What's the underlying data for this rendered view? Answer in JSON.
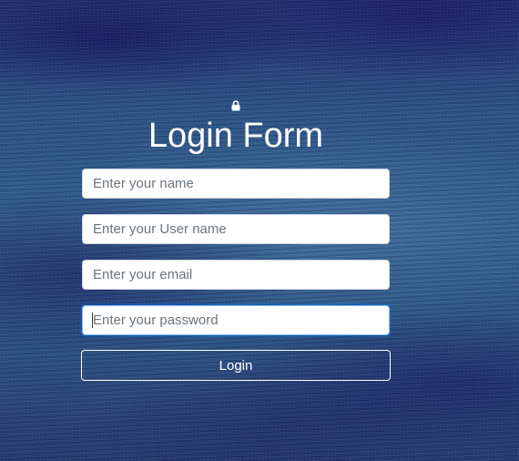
{
  "form": {
    "title": "Login Form",
    "icon": "lock-icon",
    "fields": {
      "name": {
        "placeholder": "Enter your name",
        "value": ""
      },
      "username": {
        "placeholder": "Enter your User name",
        "value": ""
      },
      "email": {
        "placeholder": "Enter your email",
        "value": ""
      },
      "password": {
        "placeholder": "Enter your password",
        "value": ""
      }
    },
    "submit_label": "Login"
  },
  "colors": {
    "text": "#ffffff",
    "field_background": "#ffffff",
    "focus_border": "#80bdff",
    "background": "#2c5486"
  }
}
